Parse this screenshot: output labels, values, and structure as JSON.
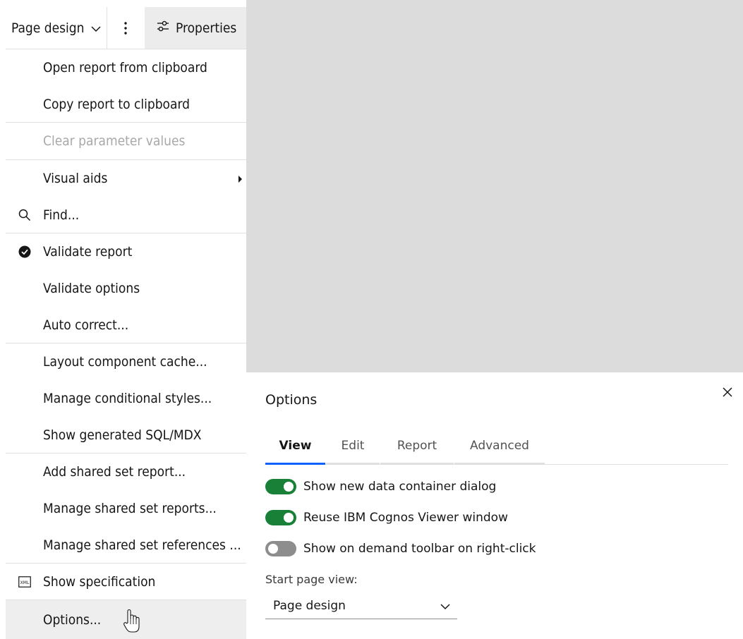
{
  "toolbar": {
    "view_selector_label": "Page design",
    "more_icon": "overflow-menu-vertical-icon",
    "properties_label": "Properties",
    "properties_icon": "settings-adjust-icon"
  },
  "menu": {
    "items": [
      {
        "label": "Open report from clipboard"
      },
      {
        "label": "Copy report to clipboard"
      },
      {
        "label": "Clear parameter values",
        "disabled": true
      },
      {
        "label": "Visual aids",
        "submenu": true
      },
      {
        "label": "Find...",
        "icon": "search-icon"
      },
      {
        "label": "Validate report",
        "icon": "checkmark-filled-icon"
      },
      {
        "label": "Validate options"
      },
      {
        "label": "Auto correct..."
      },
      {
        "label": "Layout component cache..."
      },
      {
        "label": "Manage conditional styles..."
      },
      {
        "label": "Show generated SQL/MDX"
      },
      {
        "label": "Add shared set report..."
      },
      {
        "label": "Manage shared set reports..."
      },
      {
        "label": "Manage shared set references ..."
      },
      {
        "label": "Show specification",
        "icon": "xml-icon"
      },
      {
        "label": "Options...",
        "hovered": true
      }
    ]
  },
  "dialog": {
    "title": "Options",
    "close_icon": "close-icon",
    "tabs": [
      {
        "label": "View",
        "active": true
      },
      {
        "label": "Edit"
      },
      {
        "label": "Report"
      },
      {
        "label": "Advanced"
      }
    ],
    "toggles": [
      {
        "label": "Show new data container dialog",
        "on": true
      },
      {
        "label": "Reuse IBM Cognos Viewer window",
        "on": true
      },
      {
        "label": "Show on demand toolbar on right-click",
        "on": false
      }
    ],
    "start_page_view": {
      "label": "Start page view:",
      "value": "Page design"
    }
  },
  "colors": {
    "toggle_on": "#198038",
    "toggle_off": "#8d8d8d",
    "active_tab_underline": "#0f62fe",
    "disabled_text": "#a8a8a8",
    "backdrop": "#dcdcdd"
  }
}
